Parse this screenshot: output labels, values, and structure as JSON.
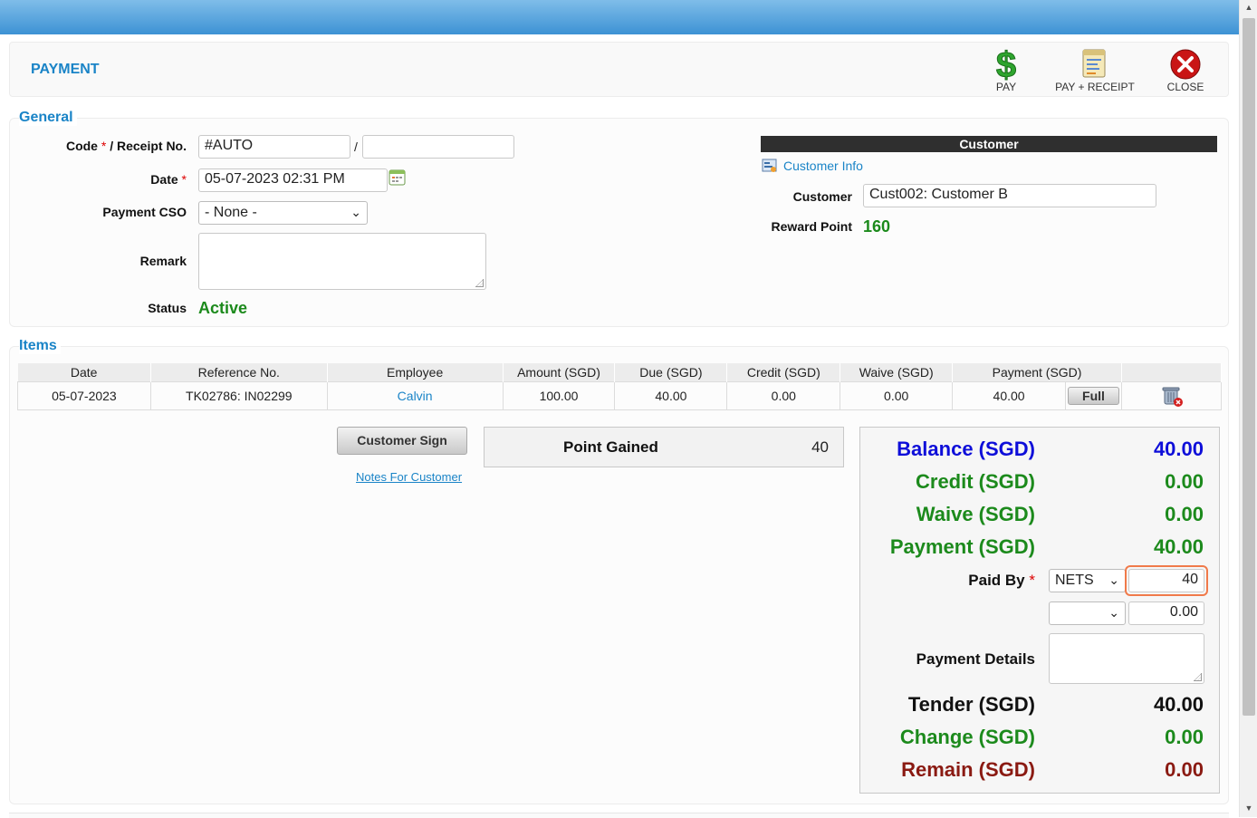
{
  "page": {
    "title": "PAYMENT"
  },
  "toolbar": {
    "pay_label": "PAY",
    "pay_receipt_label": "PAY + RECEIPT",
    "close_label": "CLOSE"
  },
  "general": {
    "legend": "General",
    "code_label": "Code",
    "receipt_label": " / Receipt No.",
    "code_value": "#AUTO",
    "separator": "/",
    "receipt_value": "",
    "date_label": "Date",
    "date_value": "05-07-2023 02:31 PM",
    "cso_label": "Payment CSO",
    "cso_value": "- None -",
    "remark_label": "Remark",
    "remark_value": "",
    "status_label": "Status",
    "status_value": "Active",
    "required_mark": "*"
  },
  "customer": {
    "header": "Customer",
    "info_link": "Customer Info",
    "customer_label": "Customer",
    "customer_value": "Cust002: Customer B",
    "reward_label": "Reward Point",
    "reward_value": "160"
  },
  "items": {
    "legend": "Items",
    "columns": [
      "Date",
      "Reference No.",
      "Employee",
      "Amount (SGD)",
      "Due (SGD)",
      "Credit (SGD)",
      "Waive (SGD)",
      "Payment (SGD)"
    ],
    "rows": [
      {
        "date": "05-07-2023",
        "reference": "TK02786: IN02299",
        "employee": "Calvin",
        "amount": "100.00",
        "due": "40.00",
        "credit": "0.00",
        "waive": "0.00",
        "payment": "40.00",
        "full_label": "Full"
      }
    ]
  },
  "actions": {
    "customer_sign": "Customer Sign",
    "notes_link": "Notes For Customer"
  },
  "points": {
    "label": "Point Gained",
    "value": "40"
  },
  "summary": {
    "balance_label": "Balance (SGD)",
    "balance_value": "40.00",
    "credit_label": "Credit (SGD)",
    "credit_value": "0.00",
    "waive_label": "Waive (SGD)",
    "waive_value": "0.00",
    "payment_label": "Payment (SGD)",
    "payment_value": "40.00",
    "paid_by_label": "Paid By",
    "paid_by_method": "NETS",
    "paid_by_amount": "40",
    "paid_by2_method": "",
    "paid_by2_amount": "0.00",
    "payment_details_label": "Payment Details",
    "payment_details_value": "",
    "tender_label": "Tender (SGD)",
    "tender_value": "40.00",
    "change_label": "Change (SGD)",
    "change_value": "0.00",
    "remain_label": "Remain (SGD)",
    "remain_value": "0.00"
  },
  "colors": {
    "accent": "#1a84c7",
    "balance": "#0e0ed9",
    "positive": "#1c8a1c",
    "remain": "#8a1a12",
    "focus": "#f07a4a"
  }
}
